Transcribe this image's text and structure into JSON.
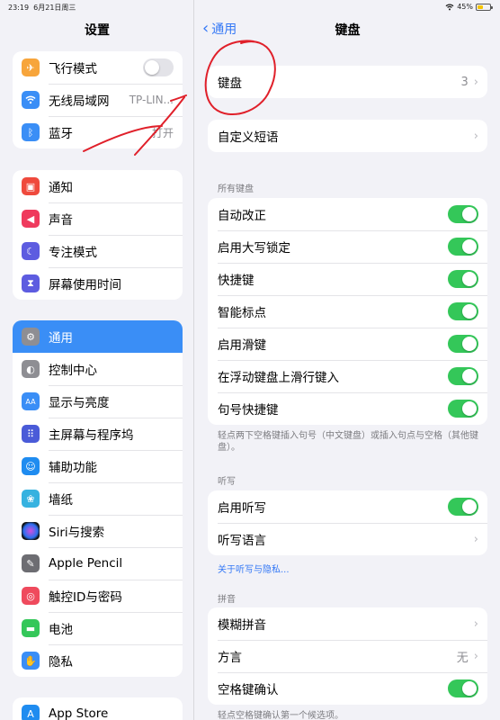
{
  "status": {
    "time": "23:19",
    "date": "6月21日周三",
    "battery": "45%"
  },
  "sidebar": {
    "title": "设置",
    "group1": [
      {
        "label": "飞行模式",
        "icon": "airplane-icon",
        "color": "#f7a53b",
        "glyph": "✈",
        "control": "toggle-off"
      },
      {
        "label": "无线局域网",
        "icon": "wifi-icon",
        "color": "#3a8ef6",
        "glyph": "◠",
        "value": "TP-LIN..."
      },
      {
        "label": "蓝牙",
        "icon": "bluetooth-icon",
        "color": "#3a8ef6",
        "glyph": "ᛒ",
        "value": "打开"
      }
    ],
    "group2": [
      {
        "label": "通知",
        "icon": "notification-icon",
        "color": "#ef4a3d",
        "glyph": "▣"
      },
      {
        "label": "声音",
        "icon": "speaker-icon",
        "color": "#ef3a5d",
        "glyph": "◀"
      },
      {
        "label": "专注模式",
        "icon": "moon-icon",
        "color": "#5d5ce0",
        "glyph": "☾"
      },
      {
        "label": "屏幕使用时间",
        "icon": "hourglass-icon",
        "color": "#5d5ce0",
        "glyph": "⧗"
      }
    ],
    "group3": [
      {
        "label": "通用",
        "icon": "gear-icon",
        "color": "#8e8e93",
        "glyph": "⚙",
        "selected": true
      },
      {
        "label": "控制中心",
        "icon": "toggles-icon",
        "color": "#8e8e93",
        "glyph": "◐"
      },
      {
        "label": "显示与亮度",
        "icon": "text-size-icon",
        "color": "#3a8ef6",
        "glyph": "AA"
      },
      {
        "label": "主屏幕与程序坞",
        "icon": "grid-icon",
        "color": "#4a5bd8",
        "glyph": "⠿"
      },
      {
        "label": "辅助功能",
        "icon": "accessibility-icon",
        "color": "#1f8cf0",
        "glyph": "☺"
      },
      {
        "label": "墙纸",
        "icon": "flower-icon",
        "color": "#36b2e0",
        "glyph": "❀"
      },
      {
        "label": "Siri与搜索",
        "icon": "siri-icon",
        "color": "#222222",
        "glyph": "◉"
      },
      {
        "label": "Apple Pencil",
        "icon": "pencil-icon",
        "color": "#6d6d72",
        "glyph": "✎"
      },
      {
        "label": "触控ID与密码",
        "icon": "fingerprint-icon",
        "color": "#ef4a5d",
        "glyph": "◎"
      },
      {
        "label": "电池",
        "icon": "battery-icon",
        "color": "#34c759",
        "glyph": "▬"
      },
      {
        "label": "隐私",
        "icon": "hand-icon",
        "color": "#3a8ef6",
        "glyph": "✋"
      }
    ],
    "group4": [
      {
        "label": "App Store",
        "icon": "appstore-icon",
        "color": "#1f8cf0",
        "glyph": "A"
      }
    ]
  },
  "main": {
    "back_label": "通用",
    "title": "键盘",
    "keyboards": {
      "label": "键盘",
      "value": "3"
    },
    "text_replacement": "自定义短语",
    "all_keyboards_header": "所有键盘",
    "all_keyboards": [
      {
        "label": "自动改正",
        "on": true
      },
      {
        "label": "启用大写锁定",
        "on": true
      },
      {
        "label": "快捷键",
        "on": true
      },
      {
        "label": "智能标点",
        "on": true
      },
      {
        "label": "启用滑键",
        "on": true
      },
      {
        "label": "在浮动键盘上滑行键入",
        "on": true
      },
      {
        "label": "句号快捷键",
        "on": true
      }
    ],
    "period_footer": "轻点两下空格键插入句号（中文键盘）或插入句点与空格（其他键盘）。",
    "dictation_header": "听写",
    "dictation": [
      {
        "label": "启用听写",
        "type": "toggle",
        "on": true
      },
      {
        "label": "听写语言",
        "type": "chevron"
      }
    ],
    "dictation_link": "关于听写与隐私...",
    "pinyin_header": "拼音",
    "pinyin": [
      {
        "label": "模糊拼音",
        "type": "chevron"
      },
      {
        "label": "方言",
        "type": "chevron",
        "value": "无"
      },
      {
        "label": "空格键确认",
        "type": "toggle",
        "on": true
      }
    ],
    "pinyin_footer": "轻点空格键确认第一个候选项。"
  },
  "colors": {
    "accent": "#3478f6",
    "toggle_on": "#34c759",
    "annotation": "#e0202a"
  }
}
